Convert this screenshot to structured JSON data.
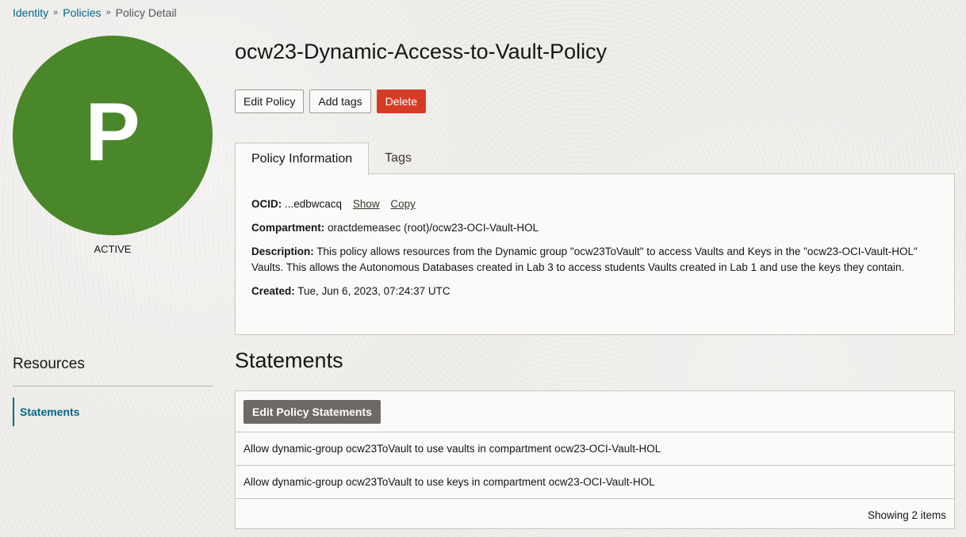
{
  "breadcrumb": {
    "items": [
      "Identity",
      "Policies"
    ],
    "current": "Policy Detail",
    "separator": "»"
  },
  "avatar": {
    "letter": "P",
    "color": "#4a862a",
    "status": "ACTIVE"
  },
  "page": {
    "title": "ocw23-Dynamic-Access-to-Vault-Policy"
  },
  "actions": {
    "edit": "Edit Policy",
    "add_tags": "Add tags",
    "delete": "Delete"
  },
  "tabs": [
    {
      "label": "Policy Information",
      "active": true
    },
    {
      "label": "Tags",
      "active": false
    }
  ],
  "info": {
    "ocid_label": "OCID:",
    "ocid_value": "...edbwcacq",
    "show": "Show",
    "copy": "Copy",
    "compartment_label": "Compartment:",
    "compartment_value": "oractdemeasec (root)/ocw23-OCI-Vault-HOL",
    "description_label": "Description:",
    "description_value": "This policy allows resources from the Dynamic group \"ocw23ToVault\" to access Vaults and Keys in the \"ocw23-OCI-Vault-HOL\" Vaults. This allows the Autonomous Databases created in Lab 3 to access students Vaults created in Lab 1 and use the keys they contain.",
    "created_label": "Created:",
    "created_value": "Tue, Jun 6, 2023, 07:24:37 UTC"
  },
  "resources": {
    "title": "Resources",
    "items": [
      {
        "label": "Statements",
        "active": true
      }
    ]
  },
  "statements": {
    "title": "Statements",
    "edit_button": "Edit Policy Statements",
    "rows": [
      "Allow dynamic-group ocw23ToVault to use vaults in compartment ocw23-OCI-Vault-HOL",
      "Allow dynamic-group ocw23ToVault to use keys in compartment ocw23-OCI-Vault-HOL"
    ],
    "footer": "Showing 2 items"
  },
  "colors": {
    "link": "#00688c",
    "danger": "#d63b25",
    "dark_button": "#6f6965"
  }
}
